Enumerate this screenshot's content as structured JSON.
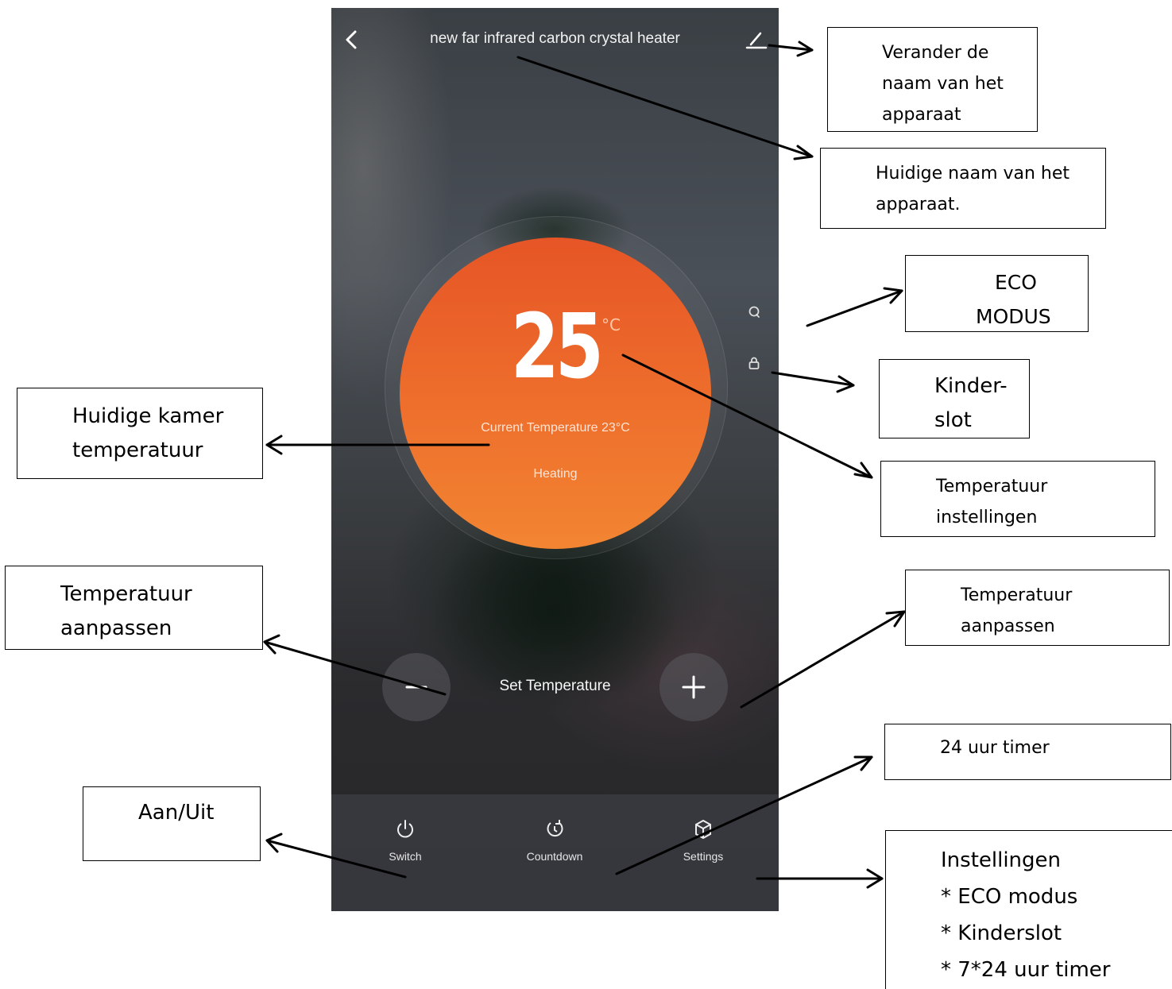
{
  "app": {
    "device_name": "new far infrared carbon crystal heater",
    "set_temperature": "25",
    "unit": "°C",
    "current_temperature": "Current Temperature 23°C",
    "status": "Heating",
    "set_label": "Set Temperature",
    "tabs": [
      {
        "label": "Switch",
        "icon": "power-icon"
      },
      {
        "label": "Countdown",
        "icon": "countdown-icon"
      },
      {
        "label": "Settings",
        "icon": "settings-icon"
      }
    ],
    "accent_color": "#ee6f2c"
  },
  "annotations": {
    "rename": [
      "Verander de",
      "naam van het",
      "apparaat"
    ],
    "current_name": [
      "Huidige naam van het",
      "apparaat."
    ],
    "eco": [
      "ECO",
      "MODUS"
    ],
    "child_lock": [
      "Kinder-",
      "slot"
    ],
    "temp_settings": [
      "Temperatuur",
      "instellingen"
    ],
    "room_temp": [
      "Huidige kamer",
      "temperatuur"
    ],
    "adjust_left": [
      "Temperatuur",
      "aanpassen"
    ],
    "adjust_right": [
      "Temperatuur",
      "aanpassen"
    ],
    "timer": [
      "24 uur timer"
    ],
    "power": [
      "Aan/Uit"
    ],
    "settings": {
      "title": "Instellingen",
      "items": [
        "*  ECO modus",
        "*  Kinderslot",
        "*  7*24 uur timer"
      ]
    }
  }
}
